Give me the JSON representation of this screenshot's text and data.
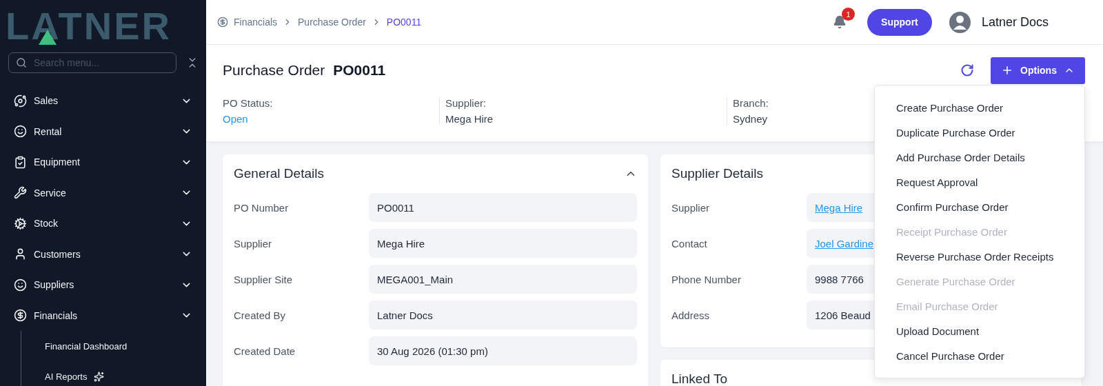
{
  "sidebar": {
    "logo": "LATNER",
    "search": {
      "placeholder": "Search menu..."
    },
    "nav": [
      {
        "label": "Sales"
      },
      {
        "label": "Rental"
      },
      {
        "label": "Equipment"
      },
      {
        "label": "Service"
      },
      {
        "label": "Stock"
      },
      {
        "label": "Customers"
      },
      {
        "label": "Suppliers"
      },
      {
        "label": "Financials",
        "children": [
          {
            "label": "Financial Dashboard",
            "ai_icon": false
          },
          {
            "label": "AI Reports",
            "ai_icon": true
          }
        ]
      }
    ]
  },
  "topbar": {
    "breadcrumbs": [
      {
        "label": "Financials",
        "current": false
      },
      {
        "label": "Purchase Order",
        "current": false
      },
      {
        "label": "PO0011",
        "current": true
      }
    ],
    "notification_count": "1",
    "support": "Support",
    "user": "Latner Docs"
  },
  "header": {
    "title": "Purchase Order",
    "number": "PO0011",
    "info": [
      {
        "label": "PO Status:",
        "value": "Open",
        "kind": "status"
      },
      {
        "label": "Supplier:",
        "value": "Mega Hire",
        "kind": "text"
      },
      {
        "label": "Branch:",
        "value": "Sydney",
        "kind": "text"
      }
    ],
    "options": {
      "label": "Options",
      "open": true,
      "menu": [
        {
          "label": "Create Purchase Order",
          "disabled": false
        },
        {
          "label": "Duplicate Purchase Order",
          "disabled": false
        },
        {
          "label": "Add Purchase Order Details",
          "disabled": false
        },
        {
          "label": "Request Approval",
          "disabled": false
        },
        {
          "label": "Confirm Purchase Order",
          "disabled": false
        },
        {
          "label": "Receipt Purchase Order",
          "disabled": true
        },
        {
          "label": "Reverse Purchase Order Receipts",
          "disabled": false
        },
        {
          "label": "Generate Purchase Order",
          "disabled": true
        },
        {
          "label": "Email Purchase Order",
          "disabled": true
        },
        {
          "label": "Upload Document",
          "disabled": false
        },
        {
          "label": "Cancel Purchase Order",
          "disabled": false
        }
      ]
    }
  },
  "general_details": {
    "title": "General Details",
    "expanded": true,
    "rows": [
      {
        "label": "PO Number",
        "value": "PO0011"
      },
      {
        "label": "Supplier",
        "value": "Mega Hire"
      },
      {
        "label": "Supplier Site",
        "value": "MEGA001_Main"
      },
      {
        "label": "Created By",
        "value": "Latner Docs"
      },
      {
        "label": "Created Date",
        "value": "30 Aug 2026 (01:30 pm)"
      }
    ]
  },
  "supplier_details": {
    "title": "Supplier Details",
    "rows": [
      {
        "label": "Supplier",
        "value": "Mega Hire",
        "kind": "link"
      },
      {
        "label": "Contact",
        "value": "Joel Gardine",
        "kind": "link"
      },
      {
        "label": "Phone Number",
        "value": "9988 7766",
        "kind": "text"
      },
      {
        "label": "Address",
        "value": "1206 Beaud",
        "kind": "text"
      }
    ]
  },
  "linked_to": {
    "title": "Linked To"
  }
}
